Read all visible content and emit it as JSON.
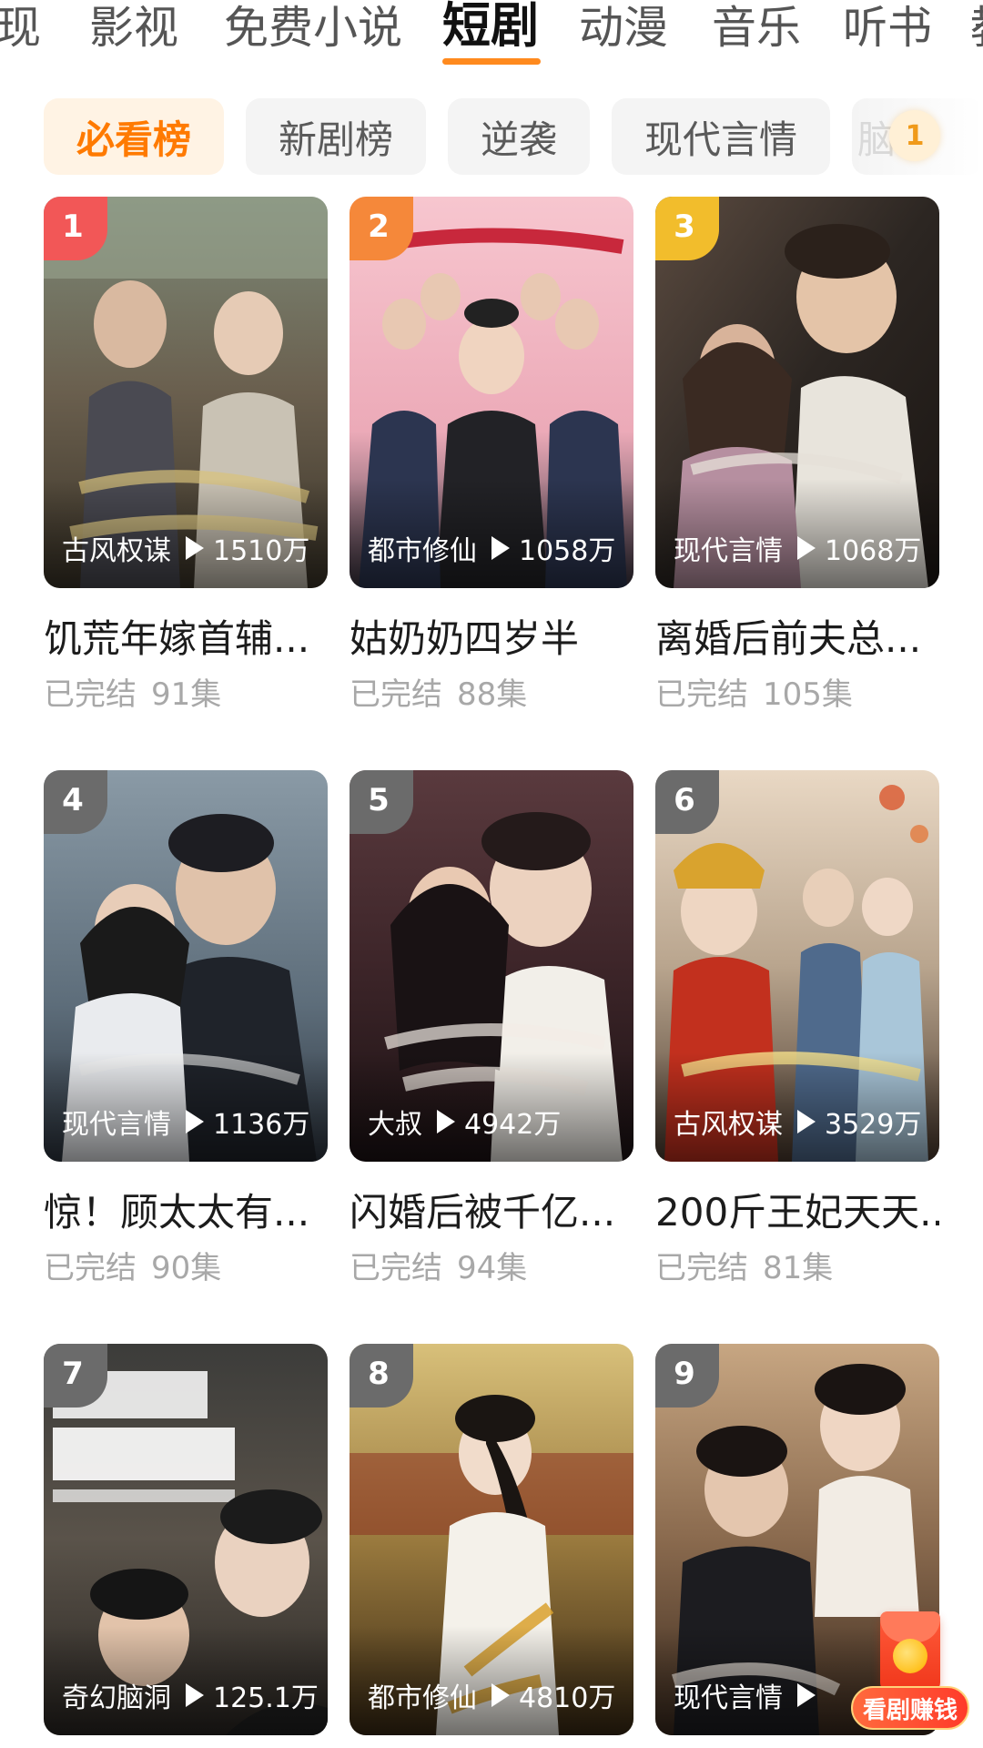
{
  "top_tabs": [
    {
      "label": "现"
    },
    {
      "label": "影视"
    },
    {
      "label": "免费小说"
    },
    {
      "label": "短剧",
      "active": true
    },
    {
      "label": "动漫"
    },
    {
      "label": "音乐"
    },
    {
      "label": "听书"
    },
    {
      "label": "教"
    }
  ],
  "chips": [
    {
      "label": "必看榜",
      "active": true
    },
    {
      "label": "新剧榜"
    },
    {
      "label": "逆袭"
    },
    {
      "label": "现代言情"
    },
    {
      "label": "脑"
    }
  ],
  "notification_count": "1",
  "cards": [
    {
      "rank": "1",
      "genre": "古风权谋",
      "plays": "1510万",
      "title": "饥荒年嫁首辅...",
      "status": "已完结",
      "episodes": "91集",
      "rank_color": "#f25757"
    },
    {
      "rank": "2",
      "genre": "都市修仙",
      "plays": "1058万",
      "title": "姑奶奶四岁半",
      "status": "已完结",
      "episodes": "88集",
      "rank_color": "#f5883a"
    },
    {
      "rank": "3",
      "genre": "现代言情",
      "plays": "1068万",
      "title": "离婚后前夫总...",
      "status": "已完结",
      "episodes": "105集",
      "rank_color": "#f2bd2c"
    },
    {
      "rank": "4",
      "genre": "现代言情",
      "plays": "1136万",
      "title": "惊！顾太太有...",
      "status": "已完结",
      "episodes": "90集",
      "rank_color": "#6b6b6b"
    },
    {
      "rank": "5",
      "genre": "大叔",
      "plays": "4942万",
      "title": "闪婚后被千亿...",
      "status": "已完结",
      "episodes": "94集",
      "rank_color": "#6b6b6b"
    },
    {
      "rank": "6",
      "genre": "古风权谋",
      "plays": "3529万",
      "title": "200斤王妃天天...",
      "status": "已完结",
      "episodes": "81集",
      "rank_color": "#6b6b6b"
    },
    {
      "rank": "7",
      "genre": "奇幻脑洞",
      "plays": "125.1万",
      "title": "",
      "status": "",
      "episodes": "",
      "rank_color": "#6b6b6b"
    },
    {
      "rank": "8",
      "genre": "都市修仙",
      "plays": "4810万",
      "title": "",
      "status": "",
      "episodes": "",
      "rank_color": "#6b6b6b"
    },
    {
      "rank": "9",
      "genre": "现代言情",
      "plays": "",
      "title": "",
      "status": "",
      "episodes": "",
      "rank_color": "#6b6b6b"
    }
  ],
  "earn_badge": {
    "label": "看剧赚钱"
  }
}
